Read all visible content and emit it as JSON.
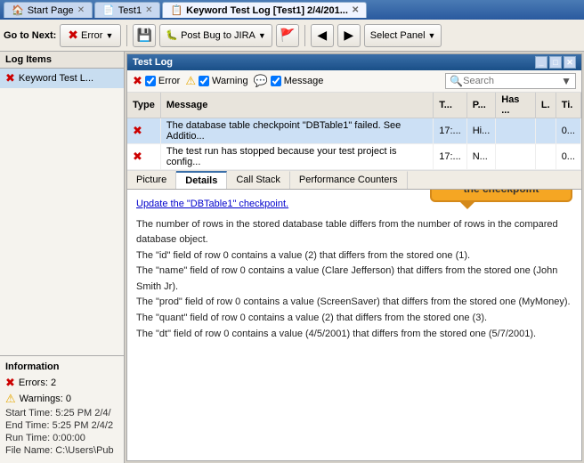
{
  "titlebar": {
    "tabs": [
      {
        "label": "Start Page",
        "icon": "home-icon",
        "active": false
      },
      {
        "label": "Test1",
        "icon": "test-icon",
        "active": false
      },
      {
        "label": "Keyword Test Log [Test1] 2/4/201...",
        "icon": "log-icon",
        "active": true
      }
    ]
  },
  "toolbar": {
    "go_to_next": "Go to Next:",
    "error_label": "Error",
    "post_bug": "Post Bug to JIRA",
    "select_panel": "Select Panel"
  },
  "left_panel": {
    "header": "Log Items",
    "items": [
      {
        "label": "Keyword Test L..."
      }
    ],
    "info": {
      "title": "Information",
      "errors": "Errors: 2",
      "warnings": "Warnings: 0",
      "start_time": "Start Time: 5:25 PM 2/4/",
      "end_time": "End Time: 5:25 PM 2/4/2",
      "run_time": "Run Time: 0:00:00",
      "file_name": "File Name: C:\\Users\\Pub"
    }
  },
  "test_log": {
    "title": "Test Log",
    "filter_error": "Error",
    "filter_warning": "Warning",
    "filter_message": "Message",
    "search_placeholder": "Search",
    "columns": [
      "Type",
      "Message",
      "T...",
      "P...",
      "Has ...",
      "L.",
      "Ti."
    ],
    "rows": [
      {
        "type": "error",
        "message": "The database table checkpoint \"DBTable1\" failed. See Additio...",
        "time": "17:...",
        "p": "Hi...",
        "has": "",
        "l": "",
        "ti": "0..."
      },
      {
        "type": "error",
        "message": "The test run has stopped because your test project is config...",
        "time": "17:...",
        "p": "N...",
        "has": "",
        "l": "",
        "ti": "0..."
      }
    ]
  },
  "tabs": {
    "items": [
      "Picture",
      "Details",
      "Call Stack",
      "Performance Counters"
    ],
    "active": "Details"
  },
  "callout": {
    "text": "Click this link to update the checkpoint"
  },
  "details": {
    "update_link": "Update the \"DBTable1\" checkpoint.",
    "paragraphs": [
      "The number of rows in the stored database table differs from the number of rows in the compared database object.",
      "The \"id\" field of row 0 contains a value (2) that differs from the stored one (1).",
      "The \"name\" field of row 0 contains a value (Clare Jefferson) that differs from the stored one (John Smith Jr).",
      "The \"prod\" field of row 0 contains a value (ScreenSaver) that differs from the stored one (MyMoney).",
      "The \"quant\" field of row 0 contains a value (2) that differs from the stored one (3).",
      "The \"dt\" field of row 0 contains a value (4/5/2001) that differs from the stored one (5/7/2001)."
    ]
  }
}
